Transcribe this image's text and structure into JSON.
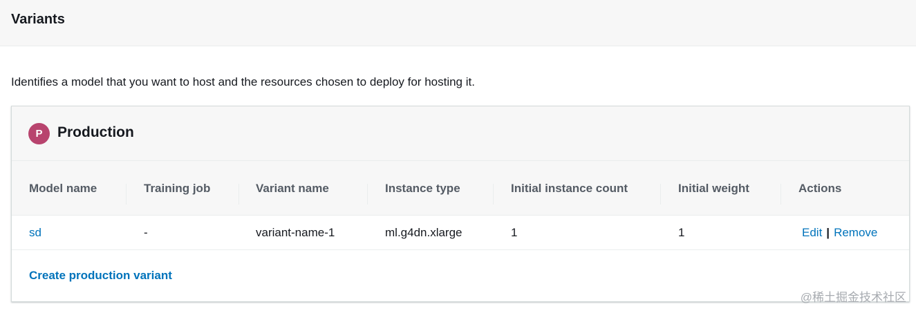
{
  "section": {
    "title": "Variants",
    "description": "Identifies a model that you want to host and the resources chosen to deploy for hosting it."
  },
  "panel": {
    "badge": "P",
    "badge_color": "#b8446e",
    "title": "Production"
  },
  "table": {
    "columns": [
      "Model name",
      "Training job",
      "Variant name",
      "Instance type",
      "Initial instance count",
      "Initial weight",
      "Actions"
    ],
    "rows": [
      {
        "model_name": "sd",
        "training_job": "-",
        "variant_name": "variant-name-1",
        "instance_type": "ml.g4dn.xlarge",
        "initial_instance_count": "1",
        "initial_weight": "1",
        "actions": {
          "edit": "Edit",
          "separator": "|",
          "remove": "Remove"
        }
      }
    ]
  },
  "footer": {
    "create_link": "Create production variant"
  },
  "watermark": "@稀土掘金技术社区",
  "colors": {
    "link": "#0073bb",
    "header_bg": "#f7f7f7",
    "border": "#eaeded"
  }
}
